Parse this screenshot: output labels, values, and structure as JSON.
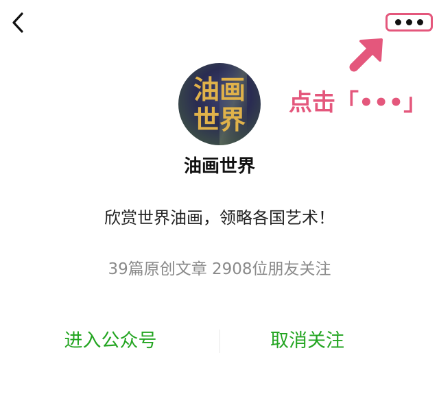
{
  "top_bar": {
    "back_icon": "chevron-left-icon",
    "more_icon": "more-horizontal-icon"
  },
  "annotation": {
    "text": "点击「•••」",
    "color": "#e4577c"
  },
  "profile": {
    "avatar_text": "油画世界",
    "avatar_line1": "油画",
    "avatar_line2": "世界",
    "name": "油画世界",
    "intro": "欣赏世界油画，领略各国艺术！",
    "stats": "39篇原创文章  2908位朋友关注"
  },
  "actions": {
    "enter_label": "进入公众号",
    "unfollow_label": "取消关注",
    "color": "#23a521"
  }
}
